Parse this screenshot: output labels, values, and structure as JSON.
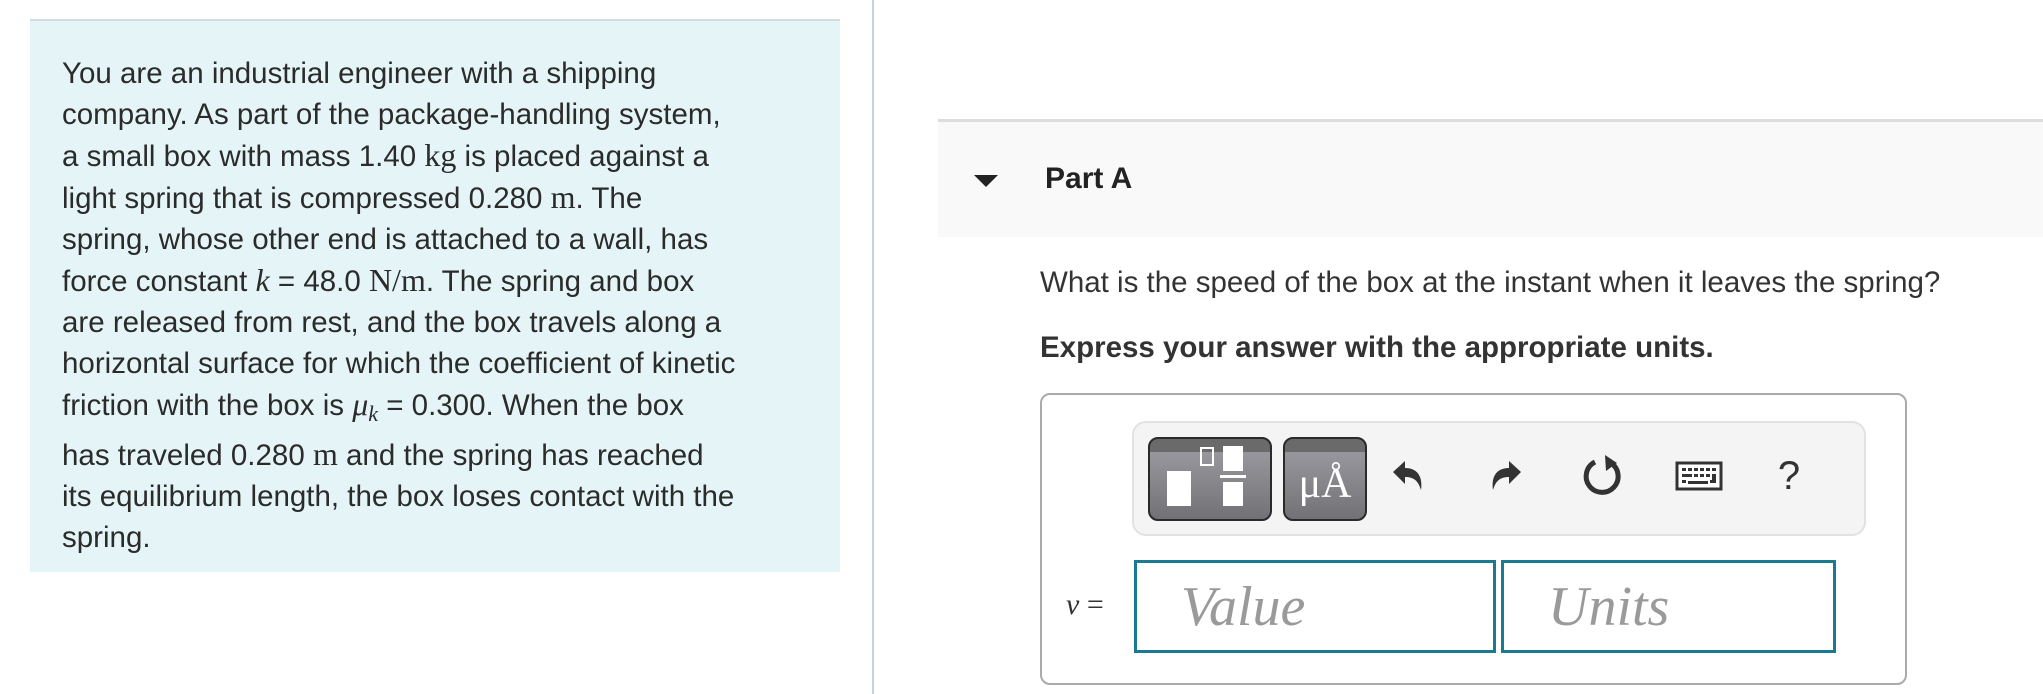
{
  "problem": {
    "lines": [
      "You are an industrial engineer with a shipping",
      "company. As part of the package-handling system,",
      "a small box with mass 1.40 ",
      "kg",
      " is placed against a",
      "light spring that is compressed 0.280 ",
      "m",
      ". The",
      "spring, whose other end is attached to a wall, has",
      "force constant ",
      "k",
      " = 48.0 ",
      "N/m",
      ". The spring and box",
      "are released from rest, and the box travels along a",
      "horizontal surface for which the coefficient of kinetic",
      "friction with the box is ",
      "μ",
      "k",
      " = 0.300. When the box",
      "has traveled 0.280 ",
      "m",
      " and the spring has reached",
      "its equilibrium length, the box loses contact with the",
      "spring."
    ]
  },
  "part": {
    "title": "Part A",
    "question": "What is the speed of the box at the instant when it leaves the spring?",
    "instruction": "Express your answer with the appropriate units."
  },
  "toolbar": {
    "units_label": "μÅ",
    "help_label": "?",
    "icons": [
      "templates-icon",
      "units-icon",
      "undo-icon",
      "redo-icon",
      "reset-icon",
      "keyboard-icon",
      "help-icon"
    ]
  },
  "answer": {
    "variable": "v",
    "equals": " =",
    "value_placeholder": "Value",
    "units_placeholder": "Units",
    "value": "",
    "units": ""
  },
  "colors": {
    "panel_bg": "#e5f5f7",
    "input_border": "#1a7a8f",
    "header_bg": "#f9f9f9"
  }
}
